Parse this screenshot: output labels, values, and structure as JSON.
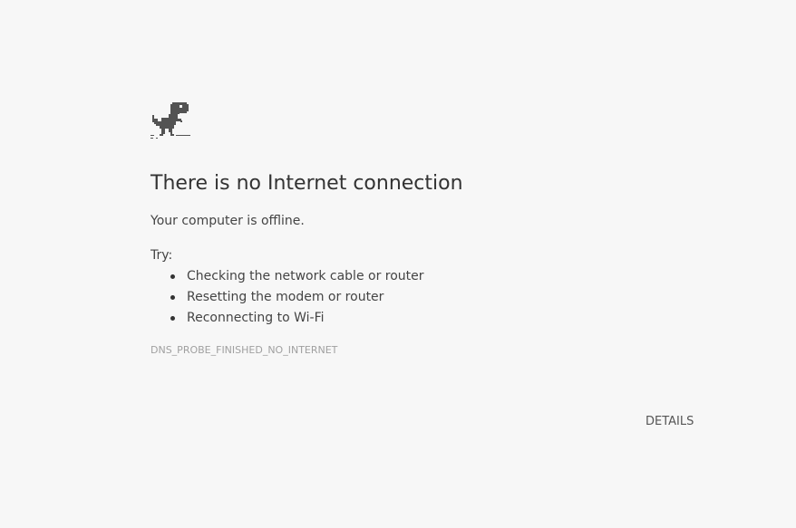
{
  "icon": "offline-dino-icon",
  "heading": "There is no Internet connection",
  "summary": "Your computer is offline.",
  "try_label": "Try:",
  "suggestions": [
    "Checking the network cable or router",
    "Resetting the modem or router",
    "Reconnecting to Wi-Fi"
  ],
  "error_code": "DNS_PROBE_FINISHED_NO_INTERNET",
  "details_label": "DETAILS",
  "colors": {
    "background": "#f7f7f7",
    "dino": "#535353",
    "error_code": "#a0a0a0"
  }
}
